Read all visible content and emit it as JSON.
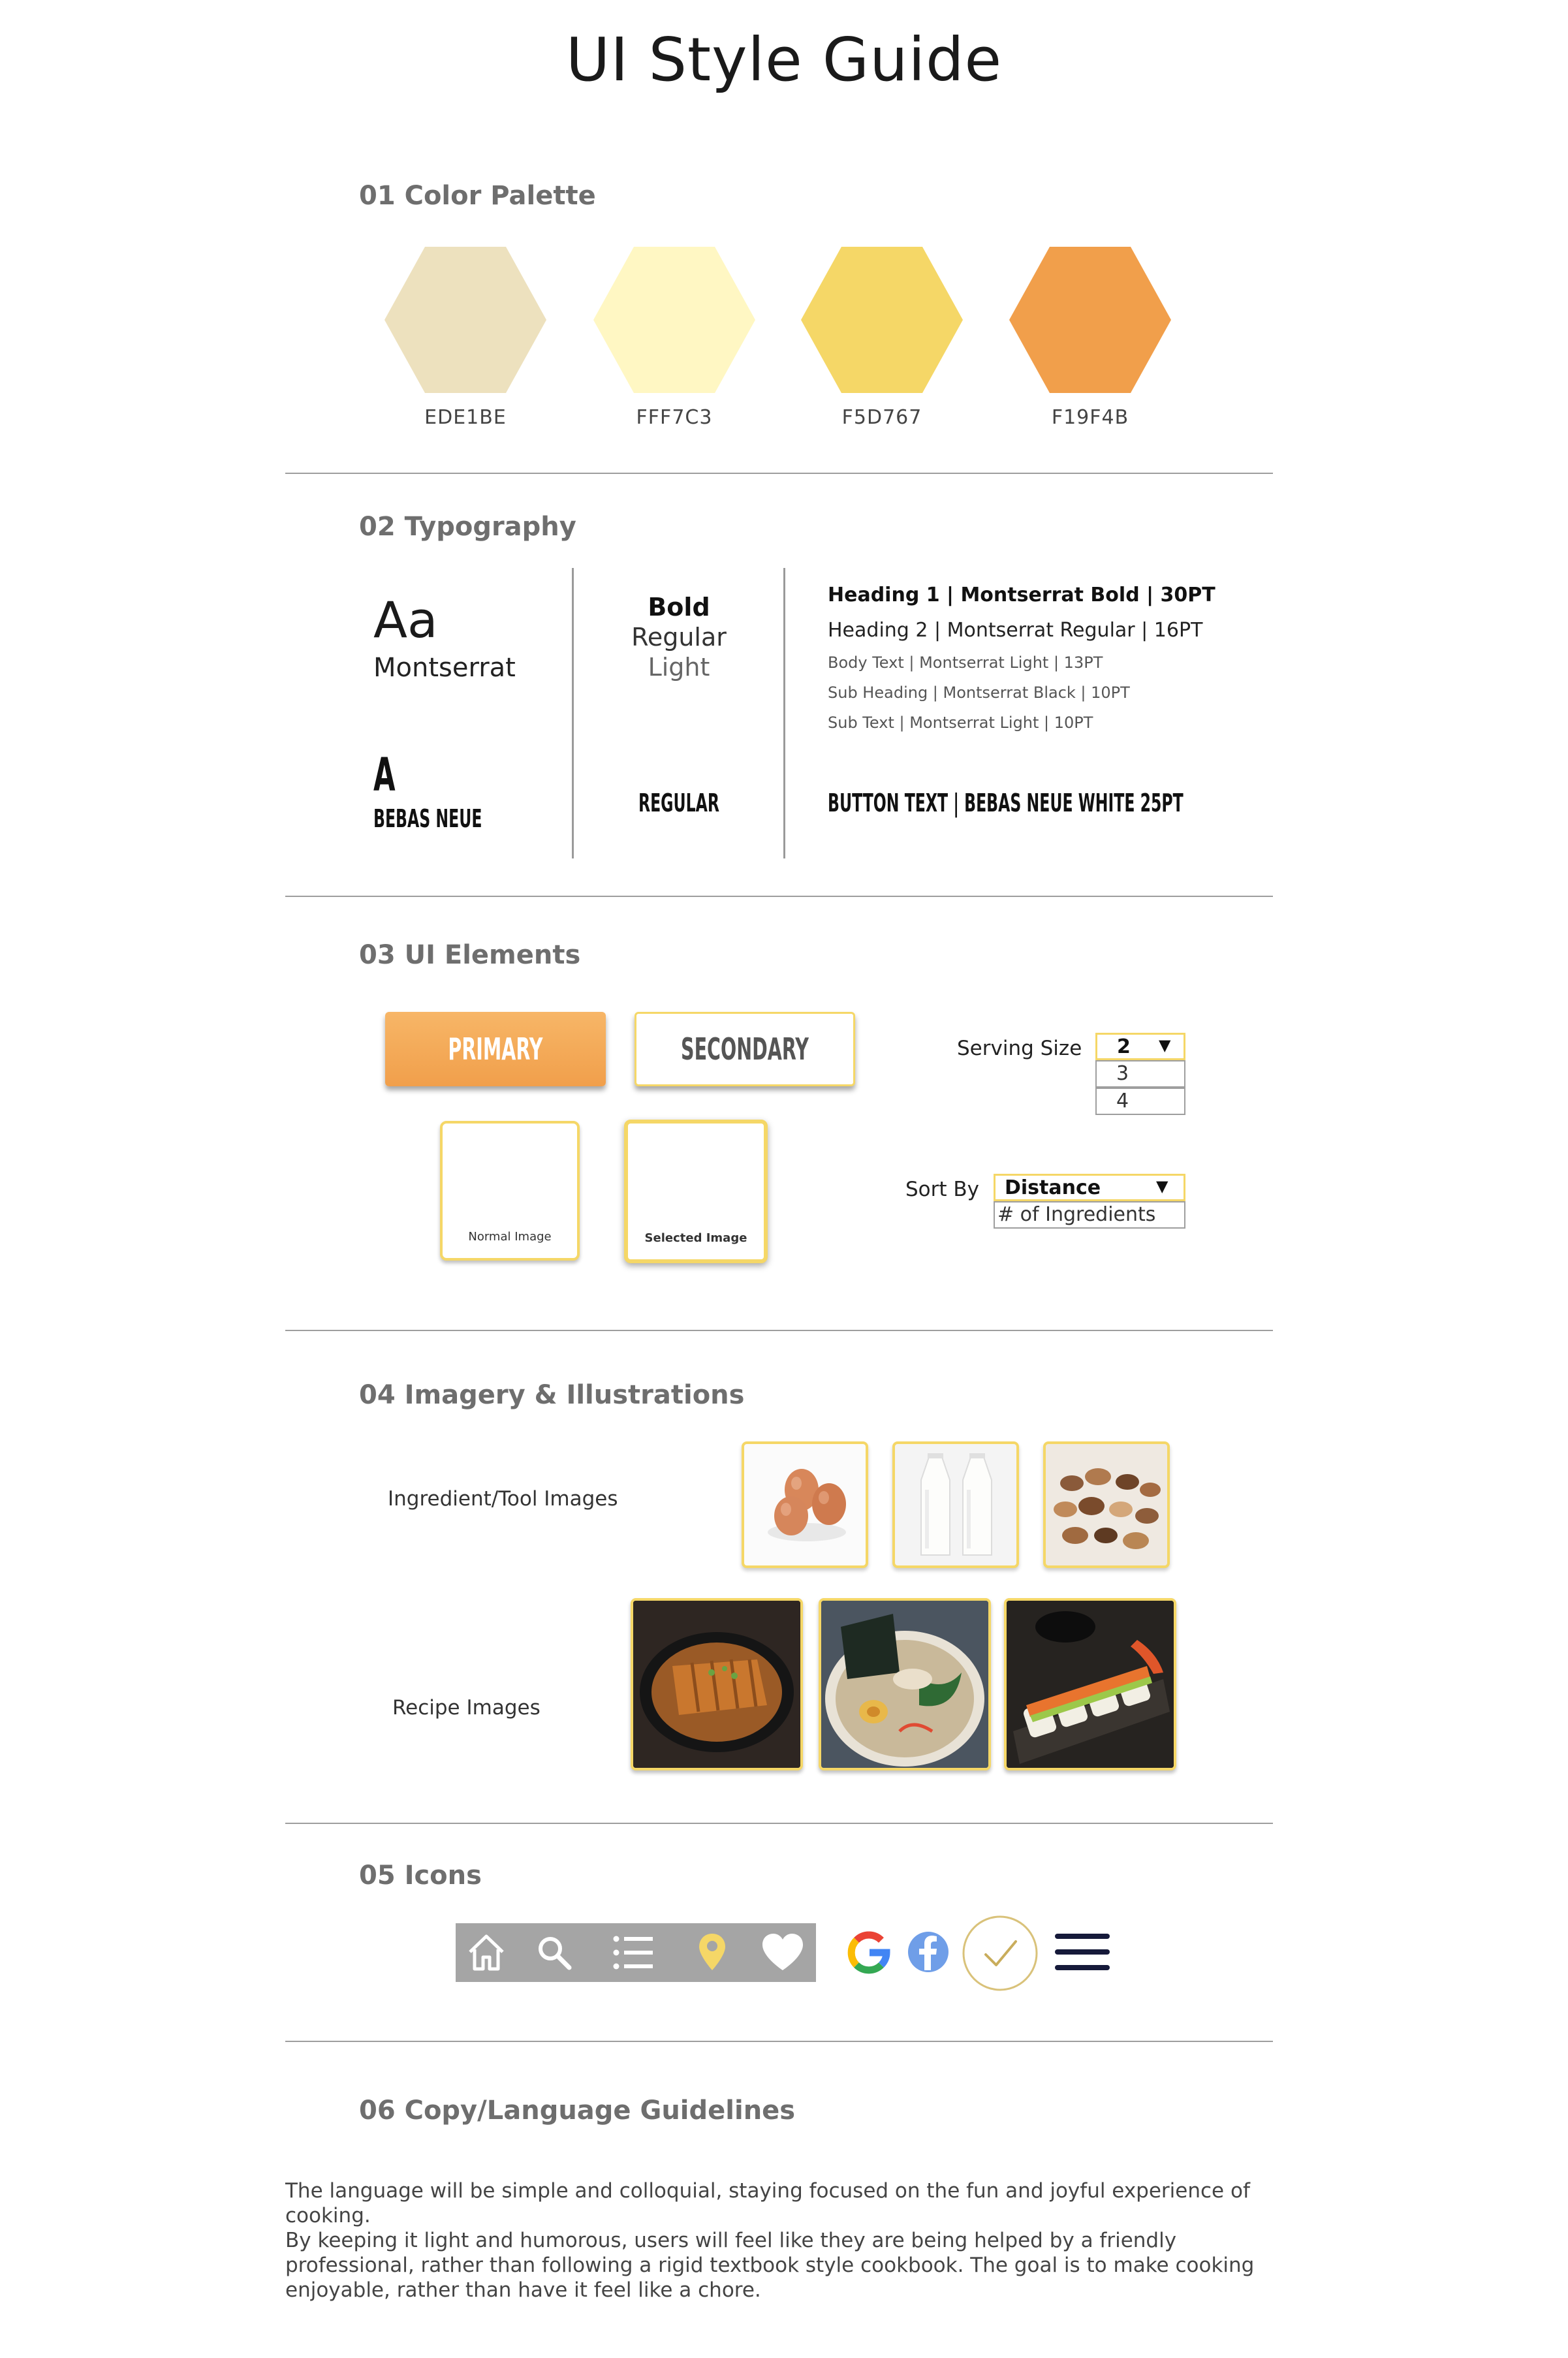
{
  "title": "UI Style Guide",
  "sections": {
    "palette": "01 Color Palette",
    "typography": "02 Typography",
    "ui_elements": "03 UI Elements",
    "imagery": "04 Imagery & Illustrations",
    "icons": "05 Icons",
    "copy": "06 Copy/Language Guidelines"
  },
  "palette": [
    {
      "code": "EDE1BE",
      "hex": "#EDE1BE"
    },
    {
      "code": "FFF7C3",
      "hex": "#FFF7C3"
    },
    {
      "code": "F5D767",
      "hex": "#F5D767"
    },
    {
      "code": "F19F4B",
      "hex": "#F19F4B"
    }
  ],
  "typography": {
    "sample": "Aa",
    "font1": "Montserrat",
    "weights": [
      "Bold",
      "Regular",
      "Light"
    ],
    "specs": [
      "Heading 1 | Montserrat Bold | 30PT",
      "Heading 2 | Montserrat Regular | 16PT",
      "Body Text | Montserrat Light | 13PT",
      "Sub Heading | Montserrat Black | 10PT",
      "Sub Text | Montserrat Light | 10PT"
    ],
    "sample2": "A",
    "font2": "BEBAS NEUE",
    "weight2": "REGULAR",
    "button_spec": "BUTTON TEXT  |  BEBAS NEUE WHITE 25PT"
  },
  "ui": {
    "primary": "PRIMARY",
    "secondary": "SECONDARY",
    "normal_image": "Normal Image",
    "selected_image": "Selected Image",
    "serving_label": "Serving Size",
    "serving_selected": "2",
    "serving_options": [
      "3",
      "4"
    ],
    "sort_label": "Sort By",
    "sort_selected": "Distance",
    "sort_options": [
      "# of Ingredients"
    ],
    "arrow": "▼"
  },
  "imagery": {
    "ingredient_label": "Ingredient/Tool Images",
    "recipe_label": "Recipe Images",
    "ingredient_images": [
      "eggs-image",
      "milk-bottles-image",
      "mixed-nuts-image"
    ],
    "recipe_images": [
      "katsu-curry-image",
      "ramen-image",
      "sushi-roll-image"
    ]
  },
  "icons": {
    "nav_bar_color": "#A5A5A5",
    "nav": [
      "home-icon",
      "search-icon",
      "list-icon",
      "location-pin-icon",
      "heart-icon"
    ],
    "social": [
      "google-icon",
      "facebook-icon",
      "checkmark-icon",
      "hamburger-menu-icon"
    ]
  },
  "copy": {
    "p1": "The language will be simple and colloquial, staying focused on the fun and joyful experience of cooking.",
    "p2": "By keeping it light and humorous, users will feel like they are being helped by a friendly professional, rather than following a rigid textbook style cookbook. The goal is to make cooking enjoyable, rather than have it feel like a chore."
  }
}
